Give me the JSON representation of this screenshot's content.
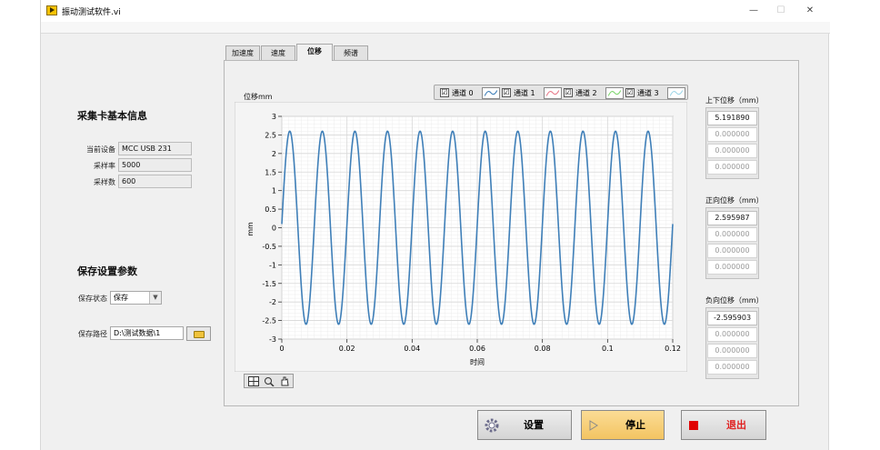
{
  "window": {
    "title": "振动测试软件.vi",
    "minimize": "—",
    "maximize": "☐",
    "close": "✕"
  },
  "left": {
    "card_info_title": "采集卡基本信息",
    "device_label": "当前设备",
    "device_value": "MCC USB 231",
    "rate_label": "采样率",
    "rate_value": "5000",
    "samples_label": "采样数",
    "samples_value": "600",
    "save_title": "保存设置参数",
    "save_state_label": "保存状态",
    "save_state_value": "保存",
    "save_path_label": "保存路径",
    "save_path_value": "D:\\测试数据\\1"
  },
  "tabs": [
    "加速度",
    "速度",
    "位移",
    "频谱"
  ],
  "active_tab": 2,
  "legend": [
    {
      "label": "通道 0",
      "checked": "☑",
      "color": "#3f7fb8"
    },
    {
      "label": "通道 1",
      "checked": "☑",
      "color": "#e87a8a"
    },
    {
      "label": "通道 2",
      "checked": "☑",
      "color": "#7fd66f"
    },
    {
      "label": "通道 3",
      "checked": "☑",
      "color": "#9fd6e8"
    }
  ],
  "chart_data": {
    "type": "line",
    "title": "位移mm",
    "xlabel": "时间",
    "ylabel": "mm",
    "xlim": [
      0,
      0.12
    ],
    "ylim": [
      -3,
      3
    ],
    "x_ticks": [
      "0",
      "0.02",
      "0.04",
      "0.06",
      "0.08",
      "0.1",
      "0.12"
    ],
    "y_ticks": [
      "3",
      "2.5",
      "2",
      "1.5",
      "1",
      "0.5",
      "0",
      "-0.5",
      "-1",
      "-1.5",
      "-2",
      "-2.5",
      "-3"
    ],
    "grid": true,
    "series": [
      {
        "name": "通道 0",
        "color": "#3f7fb8",
        "amplitude": 2.6,
        "frequency_hz": 100,
        "x_start": 0,
        "x_end": 0.12,
        "start_value": 0.1
      }
    ]
  },
  "displacement": {
    "updown_title": "上下位移（mm）",
    "updown_values": [
      "5.191890",
      "0.000000",
      "0.000000",
      "0.000000"
    ],
    "positive_title": "正向位移（mm）",
    "positive_values": [
      "2.595987",
      "0.000000",
      "0.000000",
      "0.000000"
    ],
    "negative_title": "负向位移（mm）",
    "negative_values": [
      "-2.595903",
      "0.000000",
      "0.000000",
      "0.000000"
    ]
  },
  "buttons": {
    "settings": "设置",
    "stop": "停止",
    "exit": "退出"
  },
  "colors": {
    "stop_button": "#f7cf7a",
    "exit_text": "#e02020",
    "exit_icon": "#e00000",
    "trace": "#3f7fb8"
  }
}
